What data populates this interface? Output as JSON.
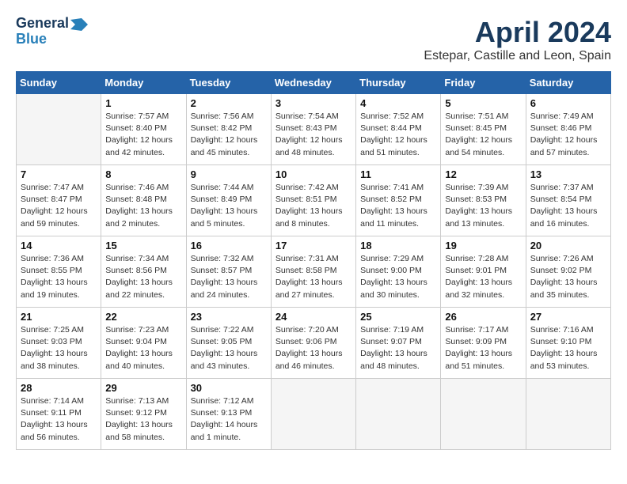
{
  "header": {
    "logo_line1": "General",
    "logo_line2": "Blue",
    "title": "April 2024",
    "subtitle": "Estepar, Castille and Leon, Spain"
  },
  "days_of_week": [
    "Sunday",
    "Monday",
    "Tuesday",
    "Wednesday",
    "Thursday",
    "Friday",
    "Saturday"
  ],
  "weeks": [
    [
      {
        "day": "",
        "info": ""
      },
      {
        "day": "1",
        "info": "Sunrise: 7:57 AM\nSunset: 8:40 PM\nDaylight: 12 hours\nand 42 minutes."
      },
      {
        "day": "2",
        "info": "Sunrise: 7:56 AM\nSunset: 8:42 PM\nDaylight: 12 hours\nand 45 minutes."
      },
      {
        "day": "3",
        "info": "Sunrise: 7:54 AM\nSunset: 8:43 PM\nDaylight: 12 hours\nand 48 minutes."
      },
      {
        "day": "4",
        "info": "Sunrise: 7:52 AM\nSunset: 8:44 PM\nDaylight: 12 hours\nand 51 minutes."
      },
      {
        "day": "5",
        "info": "Sunrise: 7:51 AM\nSunset: 8:45 PM\nDaylight: 12 hours\nand 54 minutes."
      },
      {
        "day": "6",
        "info": "Sunrise: 7:49 AM\nSunset: 8:46 PM\nDaylight: 12 hours\nand 57 minutes."
      }
    ],
    [
      {
        "day": "7",
        "info": "Sunrise: 7:47 AM\nSunset: 8:47 PM\nDaylight: 12 hours\nand 59 minutes."
      },
      {
        "day": "8",
        "info": "Sunrise: 7:46 AM\nSunset: 8:48 PM\nDaylight: 13 hours\nand 2 minutes."
      },
      {
        "day": "9",
        "info": "Sunrise: 7:44 AM\nSunset: 8:49 PM\nDaylight: 13 hours\nand 5 minutes."
      },
      {
        "day": "10",
        "info": "Sunrise: 7:42 AM\nSunset: 8:51 PM\nDaylight: 13 hours\nand 8 minutes."
      },
      {
        "day": "11",
        "info": "Sunrise: 7:41 AM\nSunset: 8:52 PM\nDaylight: 13 hours\nand 11 minutes."
      },
      {
        "day": "12",
        "info": "Sunrise: 7:39 AM\nSunset: 8:53 PM\nDaylight: 13 hours\nand 13 minutes."
      },
      {
        "day": "13",
        "info": "Sunrise: 7:37 AM\nSunset: 8:54 PM\nDaylight: 13 hours\nand 16 minutes."
      }
    ],
    [
      {
        "day": "14",
        "info": "Sunrise: 7:36 AM\nSunset: 8:55 PM\nDaylight: 13 hours\nand 19 minutes."
      },
      {
        "day": "15",
        "info": "Sunrise: 7:34 AM\nSunset: 8:56 PM\nDaylight: 13 hours\nand 22 minutes."
      },
      {
        "day": "16",
        "info": "Sunrise: 7:32 AM\nSunset: 8:57 PM\nDaylight: 13 hours\nand 24 minutes."
      },
      {
        "day": "17",
        "info": "Sunrise: 7:31 AM\nSunset: 8:58 PM\nDaylight: 13 hours\nand 27 minutes."
      },
      {
        "day": "18",
        "info": "Sunrise: 7:29 AM\nSunset: 9:00 PM\nDaylight: 13 hours\nand 30 minutes."
      },
      {
        "day": "19",
        "info": "Sunrise: 7:28 AM\nSunset: 9:01 PM\nDaylight: 13 hours\nand 32 minutes."
      },
      {
        "day": "20",
        "info": "Sunrise: 7:26 AM\nSunset: 9:02 PM\nDaylight: 13 hours\nand 35 minutes."
      }
    ],
    [
      {
        "day": "21",
        "info": "Sunrise: 7:25 AM\nSunset: 9:03 PM\nDaylight: 13 hours\nand 38 minutes."
      },
      {
        "day": "22",
        "info": "Sunrise: 7:23 AM\nSunset: 9:04 PM\nDaylight: 13 hours\nand 40 minutes."
      },
      {
        "day": "23",
        "info": "Sunrise: 7:22 AM\nSunset: 9:05 PM\nDaylight: 13 hours\nand 43 minutes."
      },
      {
        "day": "24",
        "info": "Sunrise: 7:20 AM\nSunset: 9:06 PM\nDaylight: 13 hours\nand 46 minutes."
      },
      {
        "day": "25",
        "info": "Sunrise: 7:19 AM\nSunset: 9:07 PM\nDaylight: 13 hours\nand 48 minutes."
      },
      {
        "day": "26",
        "info": "Sunrise: 7:17 AM\nSunset: 9:09 PM\nDaylight: 13 hours\nand 51 minutes."
      },
      {
        "day": "27",
        "info": "Sunrise: 7:16 AM\nSunset: 9:10 PM\nDaylight: 13 hours\nand 53 minutes."
      }
    ],
    [
      {
        "day": "28",
        "info": "Sunrise: 7:14 AM\nSunset: 9:11 PM\nDaylight: 13 hours\nand 56 minutes."
      },
      {
        "day": "29",
        "info": "Sunrise: 7:13 AM\nSunset: 9:12 PM\nDaylight: 13 hours\nand 58 minutes."
      },
      {
        "day": "30",
        "info": "Sunrise: 7:12 AM\nSunset: 9:13 PM\nDaylight: 14 hours\nand 1 minute."
      },
      {
        "day": "",
        "info": ""
      },
      {
        "day": "",
        "info": ""
      },
      {
        "day": "",
        "info": ""
      },
      {
        "day": "",
        "info": ""
      }
    ]
  ]
}
